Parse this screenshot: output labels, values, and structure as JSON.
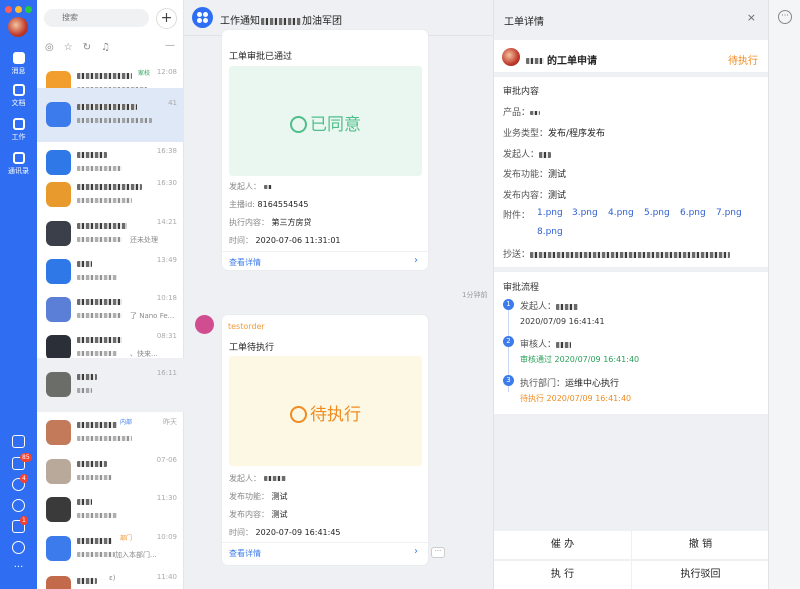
{
  "rail": {
    "nav": [
      {
        "label": "消息",
        "icon": "chat-icon"
      },
      {
        "label": "文档",
        "icon": "document-icon"
      },
      {
        "label": "工作",
        "icon": "grid-icon"
      },
      {
        "label": "通讯录",
        "icon": "contacts-icon"
      }
    ],
    "badges": {
      "todo": "85",
      "ding": "4",
      "mail": "1"
    },
    "more": "···"
  },
  "list": {
    "search_placeholder": "搜索",
    "plus": "+",
    "collapse": "—",
    "rows": [
      {
        "time": "12:08",
        "tag": "家校",
        "tag_color": "green",
        "extra": ""
      },
      {
        "time": "41",
        "tag": "",
        "extra": ""
      },
      {
        "time": "16:38",
        "tag": "",
        "extra": ""
      },
      {
        "time": "16:30",
        "tag": "",
        "extra": ""
      },
      {
        "time": "14:21",
        "tag": "",
        "extra": "还未处理"
      },
      {
        "time": "13:49",
        "tag": "",
        "extra": ""
      },
      {
        "time": "10:18",
        "tag": "",
        "extra": "了 Nano Fe..."
      },
      {
        "time": "08:31",
        "tag": "",
        "extra": "、快来..."
      },
      {
        "time": "16:11",
        "tag": "",
        "extra": ""
      },
      {
        "time": "昨天",
        "tag": "内部",
        "tag_color": "blue",
        "extra": ""
      },
      {
        "time": "07-06",
        "tag": "",
        "extra": ""
      },
      {
        "time": "11:30",
        "tag": "",
        "extra": ""
      },
      {
        "time": "10:09",
        "tag": "部门",
        "tag_color": "orange",
        "extra": "加入本部门..."
      },
      {
        "time": "11:40",
        "tag": "",
        "extra": "ε)"
      }
    ]
  },
  "chat": {
    "title": "工作通知",
    "title_suffix": "加油军团",
    "time_divider": "1分钟前",
    "cards": [
      {
        "title": "工单审批已通过",
        "stamp": "已同意",
        "fields": [
          {
            "label": "发起人：",
            "value": ""
          },
          {
            "label": "主播id:",
            "value": "8164554545"
          },
          {
            "label": "执行内容：",
            "value": "第三方房贷"
          },
          {
            "label": "时间：",
            "value": "2020-07-06 11:31:01"
          }
        ],
        "link": "查看详情"
      },
      {
        "sender": "testorder",
        "title": "工单待执行",
        "stamp": "待执行",
        "fields": [
          {
            "label": "发起人：",
            "value": ""
          },
          {
            "label": "发布功能：",
            "value": "测试"
          },
          {
            "label": "发布内容：",
            "value": "测试"
          },
          {
            "label": "时间：",
            "value": "2020-07-09 16:41:45"
          }
        ],
        "link": "查看详情"
      }
    ],
    "more": "···"
  },
  "panel": {
    "title": "工单详情",
    "close": "×",
    "app_title": "的工单申请",
    "status": "待执行",
    "content_head": "审批内容",
    "rows": [
      {
        "label": "产品：",
        "value": ""
      },
      {
        "label": "业务类型：",
        "value": "发布/程序发布"
      },
      {
        "label": "发起人：",
        "value": ""
      },
      {
        "label": "发布功能：",
        "value": "测试"
      },
      {
        "label": "发布内容：",
        "value": "测试"
      }
    ],
    "attach_label": "附件：",
    "attachments": [
      "1.png",
      "3.png",
      "4.png",
      "5.png",
      "6.png",
      "7.png",
      "8.png"
    ],
    "cc_label": "抄送：",
    "flow_head": "审批流程",
    "steps": [
      {
        "num": "1",
        "label": "发起人：",
        "sub": "2020/07/09 16:41:41",
        "sub_color": "#333333"
      },
      {
        "num": "2",
        "label": "审核人：",
        "sub": "审核通过 2020/07/09 16:41:40",
        "sub_color": "#2aa15a"
      },
      {
        "num": "3",
        "label": "执行部门：",
        "value": "运维中心执行",
        "sub": "待执行 2020/07/09 16:41:40",
        "sub_color": "#ef8b21"
      }
    ],
    "buttons": [
      "催 办",
      "撤 销",
      "执 行",
      "执行驳回"
    ]
  },
  "colors": {
    "accent": "#2f6ef2",
    "link": "#3b7bec",
    "approved": "#4fbf8a",
    "pending": "#ef8b21"
  }
}
